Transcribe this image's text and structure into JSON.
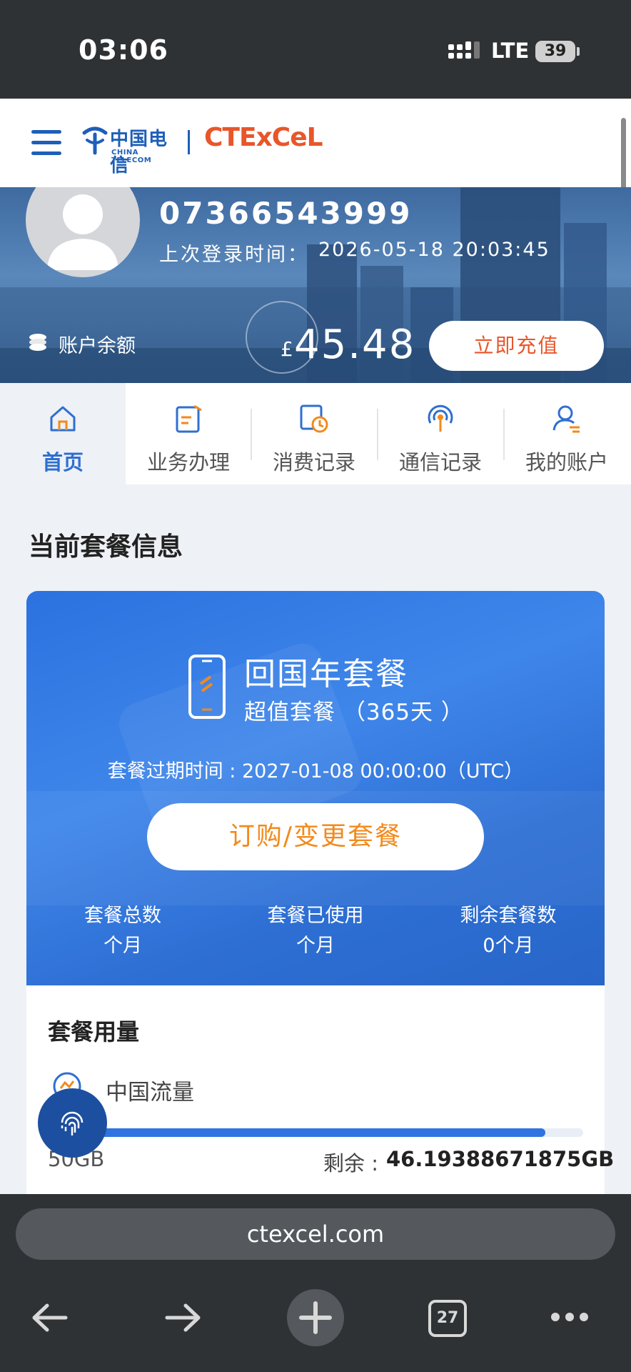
{
  "status_bar": {
    "time": "03:06",
    "network": "LTE",
    "battery": "39"
  },
  "header": {
    "logo_cn": "中国电信",
    "logo_en": "CHINA TELECOM",
    "logo_brand": "CTExCeL"
  },
  "account": {
    "phone_number": "07366543999",
    "last_login_label": "上次登录时间：",
    "last_login_time": "2026-05-18 20:03:45",
    "balance_label": "账户余额",
    "currency": "£",
    "balance": "45.48",
    "topup_label": "立即充值"
  },
  "nav": {
    "items": [
      {
        "label": "首页",
        "icon": "home-icon",
        "active": true
      },
      {
        "label": "业务办理",
        "icon": "edit-document-icon",
        "active": false
      },
      {
        "label": "消费记录",
        "icon": "bill-clock-icon",
        "active": false
      },
      {
        "label": "通信记录",
        "icon": "signal-tower-icon",
        "active": false
      },
      {
        "label": "我的账户",
        "icon": "user-icon",
        "active": false
      }
    ]
  },
  "package_section": {
    "title": "当前套餐信息",
    "name": "回国年套餐",
    "subtitle": "超值套餐 （365天 ）",
    "expire_label": "套餐过期时间 :",
    "expire_time": "2027-01-08 00:00:00（UTC）",
    "action_label": "订购/变更套餐",
    "stats": [
      {
        "label": "套餐总数",
        "value": "个月"
      },
      {
        "label": "套餐已使用",
        "value": "个月"
      },
      {
        "label": "剩余套餐数",
        "value": "0个月"
      }
    ]
  },
  "usage": {
    "title": "套餐用量",
    "item_name": "中国流量",
    "total": "50GB",
    "remain_label": "剩余 :",
    "remain_value": "46.19388671875GB",
    "remain_fraction": 0.924
  },
  "browser": {
    "url": "ctexcel.com",
    "tab_count": "27"
  },
  "colors": {
    "brand_blue": "#2f6fd0",
    "brand_orange": "#e8562a",
    "browser_dark": "#2f3235"
  }
}
